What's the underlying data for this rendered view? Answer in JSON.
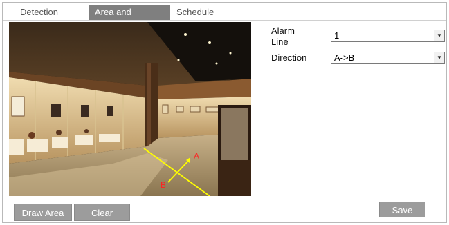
{
  "tabs": [
    {
      "label": "Detection Config",
      "active": false
    },
    {
      "label": "Area and Sensitivity",
      "active": true
    },
    {
      "label": "Schedule",
      "active": false
    }
  ],
  "settings": {
    "alarm_line_label": "Alarm Line",
    "alarm_line_value": "1",
    "direction_label": "Direction",
    "direction_value": "A->B"
  },
  "overlay": {
    "point_a": "A",
    "point_b": "B",
    "line_color": "#ffff00",
    "label_color": "#ff2020"
  },
  "buttons": {
    "draw_area": "Draw Area",
    "clear": "Clear",
    "save": "Save"
  }
}
